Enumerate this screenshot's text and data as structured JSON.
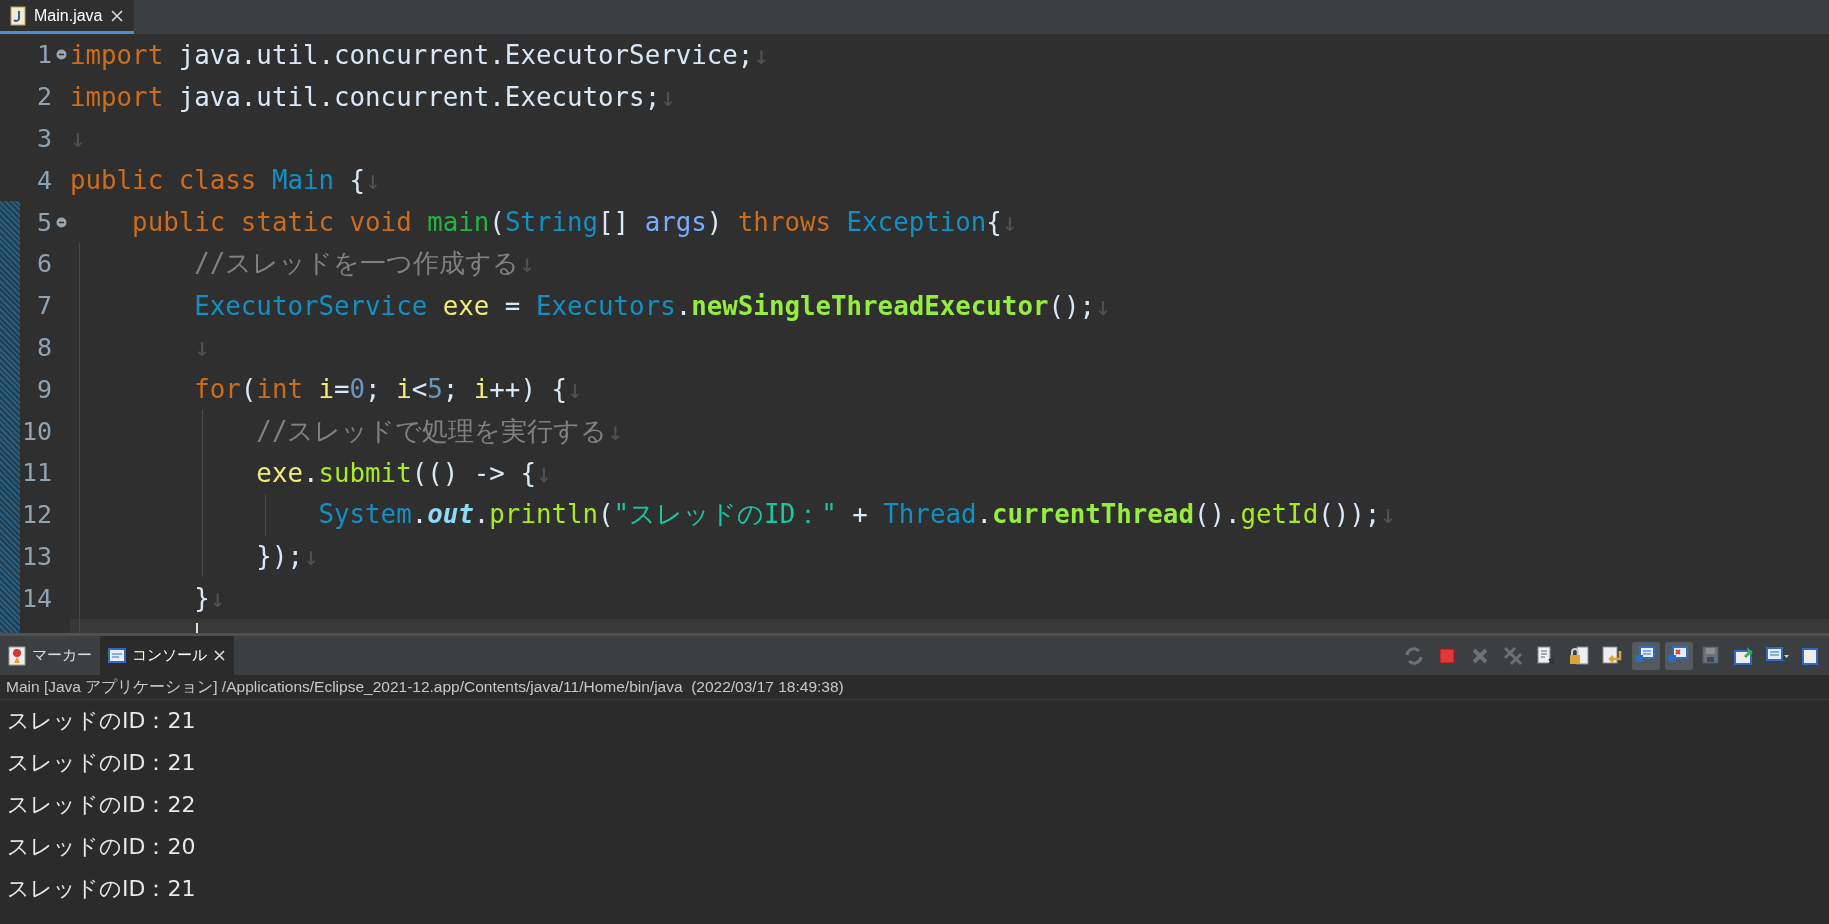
{
  "editor_tabs": [
    {
      "label": "Main.java",
      "selected": true
    }
  ],
  "code_lines": [
    {
      "num": "1",
      "fold": true,
      "current": false,
      "tokens": [
        {
          "t": "import",
          "kind": "keyword"
        },
        {
          "t": " java.util.concurrent.ExecutorService;",
          "kind": "plain"
        },
        {
          "t": "↓",
          "kind": "eol"
        }
      ]
    },
    {
      "num": "2",
      "fold": false,
      "current": false,
      "tokens": [
        {
          "t": "import",
          "kind": "keyword"
        },
        {
          "t": " java.util.concurrent.Executors;",
          "kind": "plain"
        },
        {
          "t": "↓",
          "kind": "eol"
        }
      ]
    },
    {
      "num": "3",
      "fold": false,
      "current": false,
      "tokens": [
        {
          "t": "↓",
          "kind": "eol"
        }
      ]
    },
    {
      "num": "4",
      "fold": false,
      "current": false,
      "tokens": [
        {
          "t": "public class",
          "kind": "keyword"
        },
        {
          "t": " Main",
          "kind": "type"
        },
        {
          "t": " {",
          "kind": "plain"
        },
        {
          "t": "↓",
          "kind": "eol"
        }
      ]
    },
    {
      "num": "5",
      "fold": true,
      "current": false,
      "tokens": [
        {
          "t": "    public static void",
          "kind": "keyword"
        },
        {
          "t": " main",
          "kind": "decl"
        },
        {
          "t": "(",
          "kind": "plain"
        },
        {
          "t": "String",
          "kind": "type"
        },
        {
          "t": "[] ",
          "kind": "plain"
        },
        {
          "t": "args",
          "kind": "param"
        },
        {
          "t": ") ",
          "kind": "plain"
        },
        {
          "t": "throws",
          "kind": "keyword"
        },
        {
          "t": " Exception",
          "kind": "type"
        },
        {
          "t": "{",
          "kind": "plain"
        },
        {
          "t": "↓",
          "kind": "eol"
        }
      ]
    },
    {
      "num": "6",
      "fold": false,
      "current": false,
      "tokens": [
        {
          "t": "        //スレッドを一つ作成する",
          "kind": "comment"
        },
        {
          "t": "↓",
          "kind": "eol"
        }
      ]
    },
    {
      "num": "7",
      "fold": false,
      "current": false,
      "tokens": [
        {
          "t": "        ExecutorService",
          "kind": "type"
        },
        {
          "t": " exe",
          "kind": "local"
        },
        {
          "t": " = ",
          "kind": "plain"
        },
        {
          "t": "Executors",
          "kind": "type"
        },
        {
          "t": ".",
          "kind": "plain"
        },
        {
          "t": "newSingleThreadExecutor",
          "kind": "static_call"
        },
        {
          "t": "();",
          "kind": "plain"
        },
        {
          "t": "↓",
          "kind": "eol"
        }
      ]
    },
    {
      "num": "8",
      "fold": false,
      "current": false,
      "tokens": [
        {
          "t": "        ↓",
          "kind": "eol"
        }
      ]
    },
    {
      "num": "9",
      "fold": false,
      "current": false,
      "tokens": [
        {
          "t": "        for",
          "kind": "keyword"
        },
        {
          "t": "(",
          "kind": "plain"
        },
        {
          "t": "int",
          "kind": "keyword"
        },
        {
          "t": " i",
          "kind": "local"
        },
        {
          "t": "=",
          "kind": "plain"
        },
        {
          "t": "0",
          "kind": "number"
        },
        {
          "t": "; ",
          "kind": "plain"
        },
        {
          "t": "i",
          "kind": "local"
        },
        {
          "t": "<",
          "kind": "plain"
        },
        {
          "t": "5",
          "kind": "number"
        },
        {
          "t": "; ",
          "kind": "plain"
        },
        {
          "t": "i",
          "kind": "local"
        },
        {
          "t": "++) {",
          "kind": "plain"
        },
        {
          "t": "↓",
          "kind": "eol"
        }
      ]
    },
    {
      "num": "10",
      "fold": false,
      "current": false,
      "tokens": [
        {
          "t": "            //スレッドで処理を実行する",
          "kind": "comment"
        },
        {
          "t": "↓",
          "kind": "eol"
        }
      ]
    },
    {
      "num": "11",
      "fold": false,
      "current": false,
      "tokens": [
        {
          "t": "            exe",
          "kind": "local"
        },
        {
          "t": ".",
          "kind": "plain"
        },
        {
          "t": "submit",
          "kind": "call"
        },
        {
          "t": "(() -> {",
          "kind": "plain"
        },
        {
          "t": "↓",
          "kind": "eol"
        }
      ]
    },
    {
      "num": "12",
      "fold": false,
      "current": false,
      "tokens": [
        {
          "t": "                System",
          "kind": "type"
        },
        {
          "t": ".",
          "kind": "plain"
        },
        {
          "t": "out",
          "kind": "field"
        },
        {
          "t": ".",
          "kind": "plain"
        },
        {
          "t": "println",
          "kind": "call"
        },
        {
          "t": "(",
          "kind": "plain"
        },
        {
          "t": "\"スレッドのID：\"",
          "kind": "string"
        },
        {
          "t": " + ",
          "kind": "plain"
        },
        {
          "t": "Thread",
          "kind": "type"
        },
        {
          "t": ".",
          "kind": "plain"
        },
        {
          "t": "currentThread",
          "kind": "static_call"
        },
        {
          "t": "().",
          "kind": "plain"
        },
        {
          "t": "getId",
          "kind": "call"
        },
        {
          "t": "());",
          "kind": "plain"
        },
        {
          "t": "↓",
          "kind": "eol"
        }
      ]
    },
    {
      "num": "13",
      "fold": false,
      "current": false,
      "tokens": [
        {
          "t": "            });",
          "kind": "plain"
        },
        {
          "t": "↓",
          "kind": "eol"
        }
      ]
    },
    {
      "num": "14",
      "fold": false,
      "current": false,
      "tokens": [
        {
          "t": "        }",
          "kind": "plain"
        },
        {
          "t": "↓",
          "kind": "eol"
        }
      ]
    },
    {
      "current": true
    }
  ],
  "console_tabs": [
    {
      "label": "マーカー",
      "kind": "markers",
      "selected": false
    },
    {
      "label": "コンソール",
      "kind": "console",
      "selected": true
    }
  ],
  "console_toolbar": [
    {
      "kind": "sync",
      "disabled": true,
      "pressed": false
    },
    {
      "kind": "terminate",
      "disabled": false,
      "pressed": false
    },
    {
      "kind": "remove",
      "disabled": true,
      "pressed": false
    },
    {
      "kind": "remove_all",
      "disabled": true,
      "pressed": false
    },
    {
      "kind": "clear",
      "disabled": false,
      "pressed": false
    },
    {
      "kind": "lock",
      "disabled": false,
      "pressed": false
    },
    {
      "kind": "wrap",
      "disabled": false,
      "pressed": false
    },
    {
      "kind": "stdout",
      "disabled": false,
      "pressed": true
    },
    {
      "kind": "stderr",
      "disabled": false,
      "pressed": true
    },
    {
      "kind": "save",
      "disabled": true,
      "pressed": false
    },
    {
      "kind": "pin",
      "disabled": false,
      "pressed": false
    },
    {
      "kind": "display",
      "disabled": false,
      "pressed": false
    },
    {
      "kind": "new",
      "disabled": false,
      "pressed": false
    }
  ],
  "console_header": "Main [Java アプリケーション] /Applications/Eclipse_2021-12.app/Contents/java/11/Home/bin/java  (2022/03/17 18:49:38)",
  "console_output": [
    "スレッドのID：21",
    "スレッドのID：21",
    "スレッドのID：22",
    "スレッドのID：20",
    "スレッドのID：21"
  ]
}
